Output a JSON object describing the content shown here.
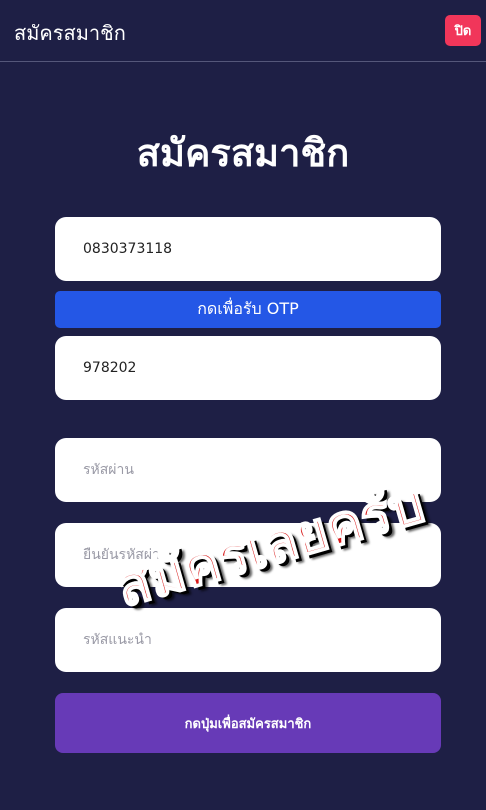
{
  "header": {
    "title": "สมัครสมาชิก",
    "close_label": "ปิด"
  },
  "page_title": "สมัครสมาชิก",
  "form": {
    "phone_value": "0830373118",
    "otp_button_label": "กดเพื่อรับ OTP",
    "otp_value": "978202",
    "password_placeholder": "รหัสผ่าน",
    "confirm_password_placeholder": "ยืนยันรหัสผ่าน",
    "referral_placeholder": "รหัสแนะนำ",
    "submit_label": "กดปุ่มเพื่อสมัครสมาชิก"
  },
  "overlay_text": "สมัครเลยครับ",
  "colors": {
    "background": "#1e1f45",
    "close_button": "#f1365a",
    "otp_button": "#2457e6",
    "submit_button": "#673ab7",
    "overlay_text": "#d81818"
  }
}
